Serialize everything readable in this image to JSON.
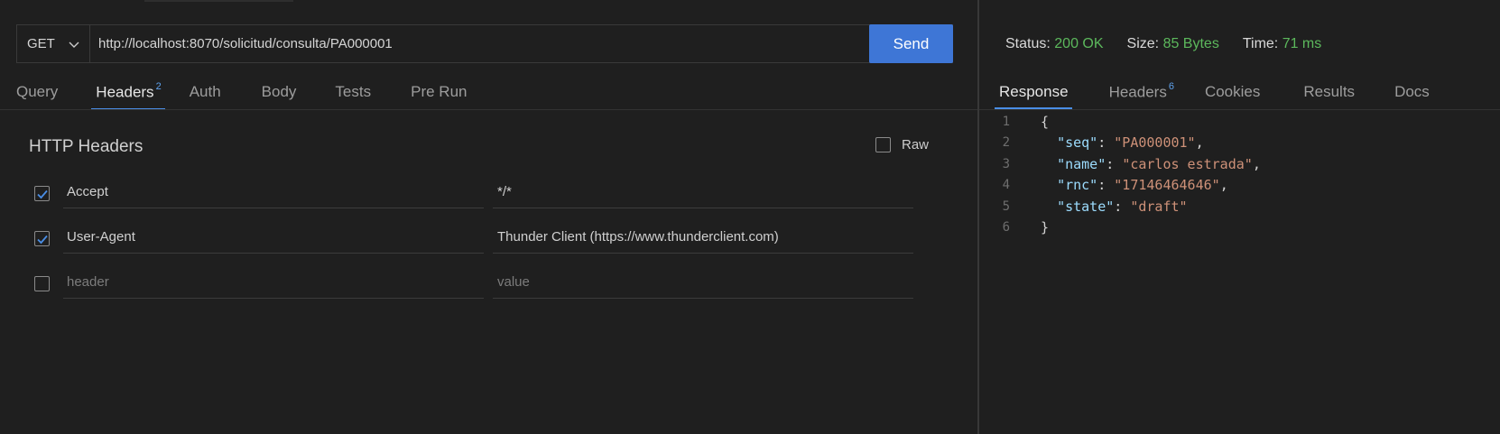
{
  "request": {
    "method": "GET",
    "url": "http://localhost:8070/solicitud/consulta/PA000001",
    "send_label": "Send"
  },
  "request_tabs": [
    {
      "label": "Query",
      "badge": ""
    },
    {
      "label": "Headers",
      "badge": "2"
    },
    {
      "label": "Auth",
      "badge": ""
    },
    {
      "label": "Body",
      "badge": ""
    },
    {
      "label": "Tests",
      "badge": ""
    },
    {
      "label": "Pre Run",
      "badge": ""
    }
  ],
  "headers_section": {
    "title": "HTTP Headers",
    "raw_label": "Raw",
    "rows": [
      {
        "checked": true,
        "key": "Accept",
        "value": "*/*"
      },
      {
        "checked": true,
        "key": "User-Agent",
        "value": "Thunder Client (https://www.thunderclient.com)"
      }
    ],
    "new_row": {
      "key_placeholder": "header",
      "value_placeholder": "value"
    }
  },
  "response_status": {
    "status_label": "Status:",
    "status_value": "200 OK",
    "size_label": "Size:",
    "size_value": "85 Bytes",
    "time_label": "Time:",
    "time_value": "71 ms"
  },
  "response_tabs": [
    {
      "label": "Response",
      "badge": ""
    },
    {
      "label": "Headers",
      "badge": "6"
    },
    {
      "label": "Cookies",
      "badge": ""
    },
    {
      "label": "Results",
      "badge": ""
    },
    {
      "label": "Docs",
      "badge": ""
    }
  ],
  "response_body": {
    "line_numbers": [
      "1",
      "2",
      "3",
      "4",
      "5",
      "6"
    ],
    "open_brace": "{",
    "close_brace": "}",
    "fields": [
      {
        "key": "\"seq\"",
        "value": "\"PA000001\"",
        "comma": ","
      },
      {
        "key": "\"name\"",
        "value": "\"carlos estrada\"",
        "comma": ","
      },
      {
        "key": "\"rnc\"",
        "value": "\"17146464646\"",
        "comma": ","
      },
      {
        "key": "\"state\"",
        "value": "\"draft\"",
        "comma": ""
      }
    ]
  },
  "colors": {
    "accent": "#3e76d6",
    "tab_underline": "#4a8ee6",
    "success": "#5cb85c",
    "json_key": "#9cdcfe",
    "json_string": "#ce9178"
  }
}
